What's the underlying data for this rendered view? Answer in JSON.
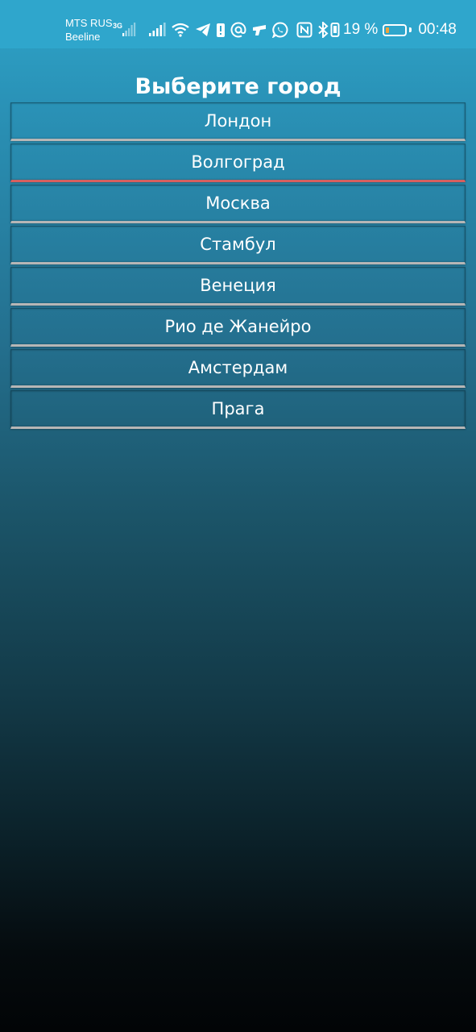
{
  "status_bar": {
    "carrier_primary": "MTS RUS",
    "carrier_secondary": "Beeline",
    "network_type": "3G",
    "icons": [
      "signal-icon",
      "signal-icon",
      "wifi-icon",
      "telegram-icon",
      "notification-icon",
      "at-icon",
      "vpn-key-icon",
      "whatsapp-icon",
      "nfc-icon",
      "bluetooth-icon",
      "vibrate-icon"
    ],
    "battery_percent_text": "19 %",
    "battery_level": 0.19,
    "time": "00:48"
  },
  "title": "Выберите город",
  "cities": [
    {
      "label": "Лондон"
    },
    {
      "label": "Волгоград"
    },
    {
      "label": "Москва"
    },
    {
      "label": "Стамбул"
    },
    {
      "label": "Венеция"
    },
    {
      "label": "Рио де Жанейро"
    },
    {
      "label": "Амстердам"
    },
    {
      "label": "Прага"
    }
  ],
  "selected_city": "Волгоград",
  "colors": {
    "status_bar": "#2fa6cc",
    "gradient_top": "#2ea4c8",
    "gradient_bottom": "#020406",
    "item_underline": "#b6b6b6",
    "selected_underline": "#d6605f",
    "battery_fill": "#f2a33a"
  }
}
